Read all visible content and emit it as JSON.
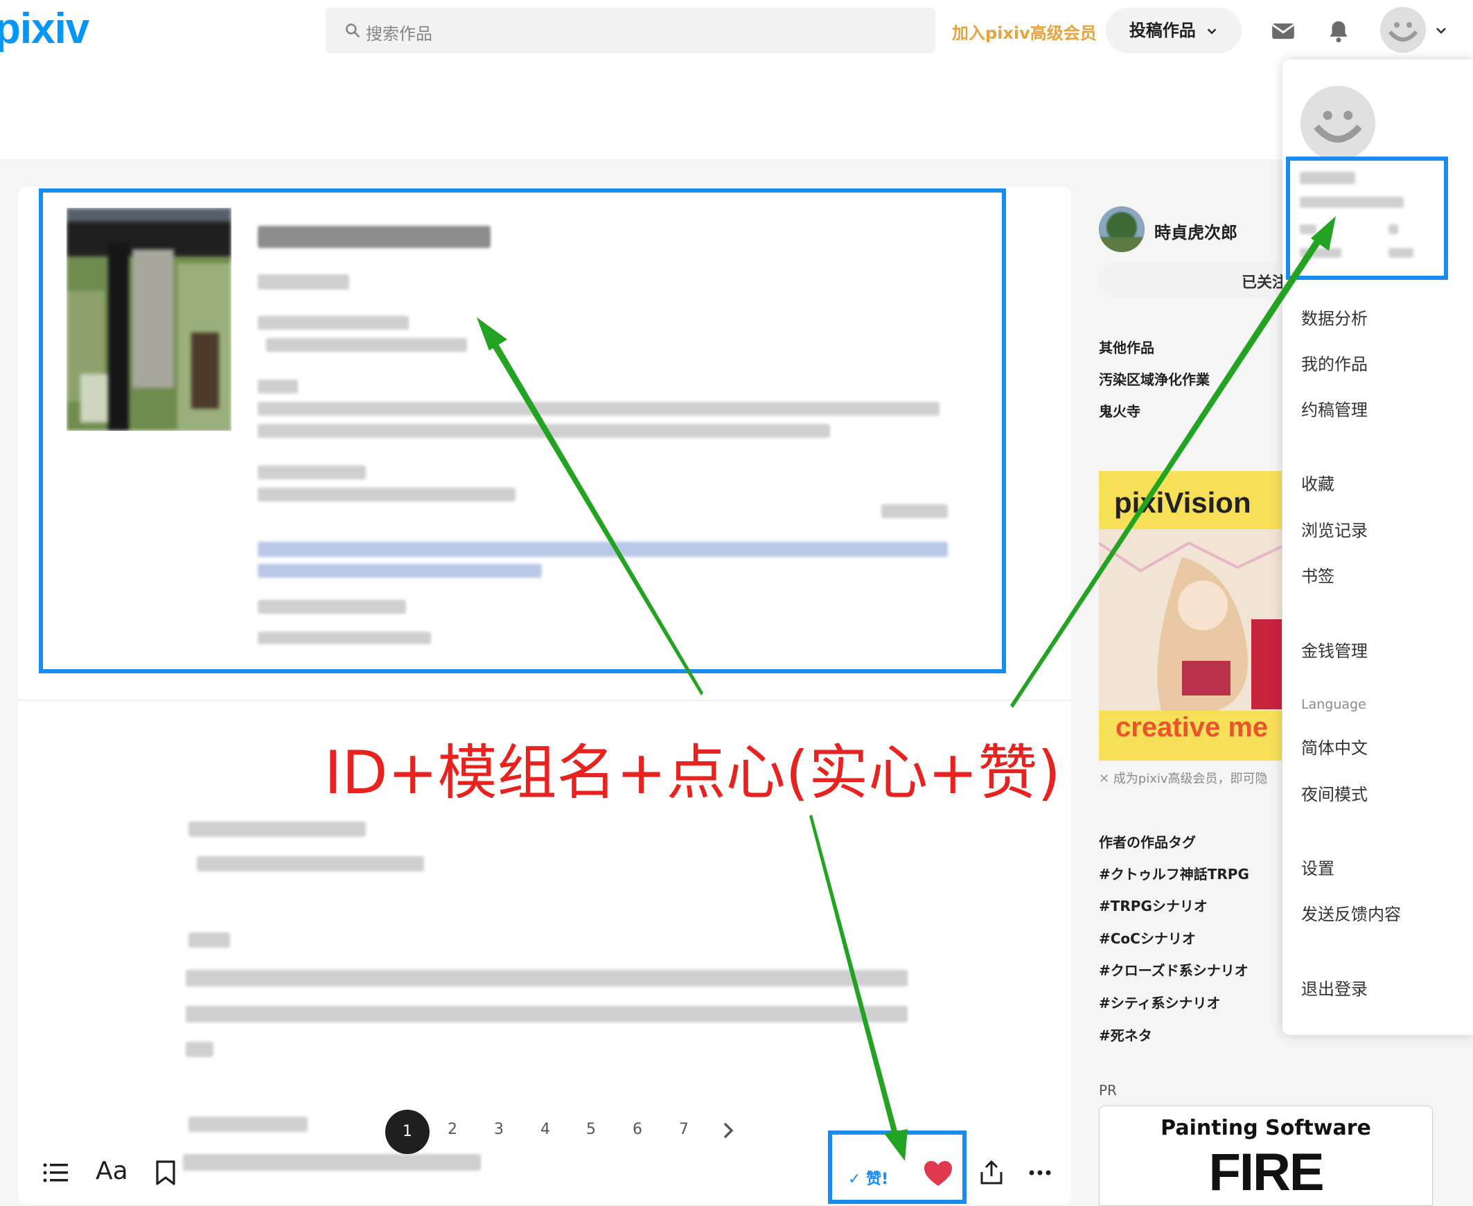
{
  "header": {
    "logo": "pixiv",
    "search_placeholder": "搜索作品",
    "premium": "加入pixiv高级会员",
    "post_button": "投稿作品"
  },
  "annotation": {
    "text": "ID+模组名+点心(实心+赞)"
  },
  "sidebar": {
    "author_name": "時貞虎次郎",
    "follow_button": "已关注",
    "other_works_label": "其他作品",
    "other_works": [
      "汚染区域浄化作業",
      "鬼火寺"
    ],
    "banner_title": "pixiVision",
    "banner_footer": "creative me",
    "banner_note": "成为pixiv高级会员，即可隐",
    "tags_label": "作者の作品タグ",
    "tags": [
      "#クトゥルフ神話TRPG",
      "#TRPGシナリオ",
      "#CoCシナリオ",
      "#クローズド系シナリオ",
      "#シティ系シナリオ",
      "#死ネタ"
    ],
    "pr_label": "PR",
    "pr_line1": "Painting Software",
    "pr_line2": "FIRE ALPACA"
  },
  "menu": {
    "items_group1": [
      "数据分析",
      "我的作品",
      "约稿管理"
    ],
    "items_group2": [
      "收藏",
      "浏览记录",
      "书签"
    ],
    "items_group3": [
      "金钱管理"
    ],
    "language_label": "Language",
    "language_value": "简体中文",
    "night_mode": "夜间模式",
    "items_group4": [
      "设置",
      "发送反馈内容"
    ],
    "logout": "退出登录"
  },
  "pager": {
    "current": "1",
    "pages": [
      "2",
      "3",
      "4",
      "5",
      "6",
      "7"
    ]
  },
  "toolbar": {
    "font_button": "Aa",
    "like_label": "✓ 赞!"
  },
  "colors": {
    "brand": "#0096fa",
    "premium": "#e8a33a",
    "annotation_box": "#1a8cf0",
    "annotation_arrow": "#22a322",
    "annotation_text": "#e8231f",
    "heart": "#e0384f"
  },
  "icons": [
    "search-icon",
    "mail-icon",
    "bell-icon",
    "chevron-down-icon",
    "list-icon",
    "bookmark-icon",
    "heart-icon",
    "share-icon",
    "more-icon",
    "chevron-right-icon",
    "close-icon"
  ]
}
